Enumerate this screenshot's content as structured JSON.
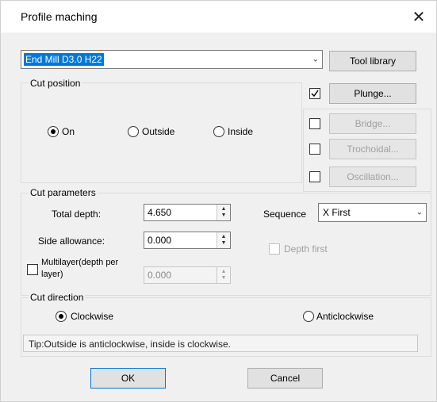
{
  "window": {
    "title": "Profile maching",
    "close_glyph": "✕"
  },
  "tool": {
    "selected": "End Mill D3.0 H22",
    "library_label": "Tool library"
  },
  "cut_position": {
    "label": "Cut position",
    "options": [
      "On",
      "Outside",
      "Inside"
    ],
    "selected": "On"
  },
  "side_options": {
    "plunge": {
      "label": "Plunge...",
      "checked": true,
      "enabled": true
    },
    "bridge": {
      "label": "Bridge...",
      "checked": false,
      "enabled": false
    },
    "trochoidal": {
      "label": "Trochoidal...",
      "checked": false,
      "enabled": false
    },
    "oscillation": {
      "label": "Oscillation...",
      "checked": false,
      "enabled": false
    }
  },
  "cut_parameters": {
    "label": "Cut parameters",
    "total_depth_label": "Total depth:",
    "total_depth": "4.650",
    "side_allowance_label": "Side allowance:",
    "side_allowance": "0.000",
    "multilayer_label_line1": "Multilayer(depth per",
    "multilayer_label_line2": "layer)",
    "multilayer_checked": false,
    "multilayer_value": "0.000",
    "sequence_label": "Sequence",
    "sequence_value": "X First",
    "depth_first_label": "Depth first",
    "depth_first_checked": false
  },
  "cut_direction": {
    "label": "Cut direction",
    "options": [
      "Clockwise",
      "Anticlockwise"
    ],
    "selected": "Clockwise"
  },
  "tip": "Tip:Outside is anticlockwise, inside is clockwise.",
  "buttons": {
    "ok": "OK",
    "cancel": "Cancel"
  },
  "colors": {
    "selection_highlight": "#0078d7",
    "dialog_bg": "#f0f0f0"
  }
}
